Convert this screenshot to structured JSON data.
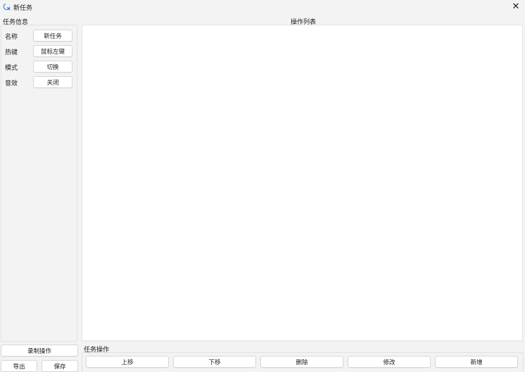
{
  "window": {
    "title": "新任务",
    "icon": "app-logo-icon",
    "close_glyph": "✕"
  },
  "task_info": {
    "group_title": "任务信息",
    "fields": [
      {
        "label": "名称",
        "value": "新任务"
      },
      {
        "label": "热键",
        "value": "鼠标左键"
      },
      {
        "label": "模式",
        "value": "切换"
      },
      {
        "label": "音效",
        "value": "关闭"
      }
    ],
    "record_button": "录制操作",
    "export_button": "导出",
    "save_button": "保存"
  },
  "operations_list": {
    "title": "操作列表",
    "items": []
  },
  "task_operations": {
    "group_title": "任务操作",
    "buttons": {
      "move_up": "上移",
      "move_down": "下移",
      "delete": "删除",
      "modify": "修改",
      "add": "新增"
    }
  }
}
